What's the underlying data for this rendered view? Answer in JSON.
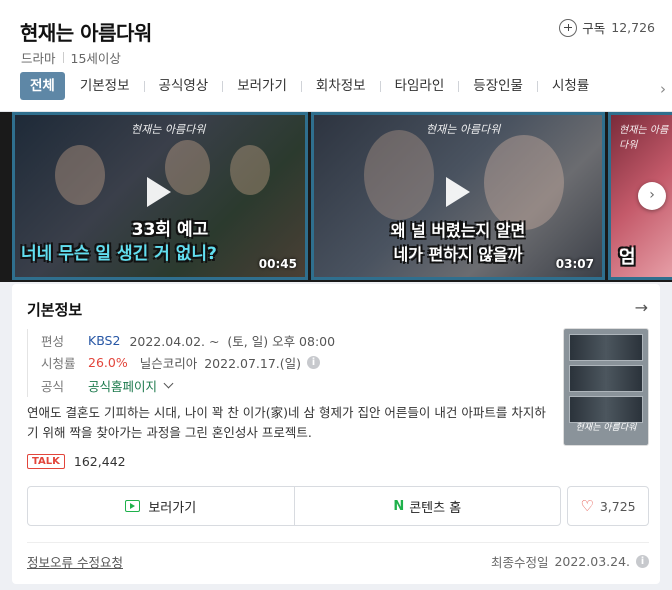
{
  "header": {
    "title": "현재는 아름다워",
    "genre": "드라마",
    "rating": "15세이상",
    "subscribe_label": "구독",
    "subscribe_count": "12,726"
  },
  "tabs": [
    {
      "label": "전체",
      "active": true
    },
    {
      "label": "기본정보"
    },
    {
      "label": "공식영상"
    },
    {
      "label": "보러가기"
    },
    {
      "label": "회차정보"
    },
    {
      "label": "타임라인"
    },
    {
      "label": "등장인물"
    },
    {
      "label": "시청률"
    }
  ],
  "videos": [
    {
      "logo": "현재는 아름다워",
      "caption_top": "33회 예고",
      "caption_bottom": "너네 무슨 일 생긴 거 없니?",
      "duration": "00:45"
    },
    {
      "logo": "현재는 아름다워",
      "caption_top": "왜 널 버렸는지 알면",
      "caption_bottom": "네가 편하지 않을까",
      "duration": "03:07"
    },
    {
      "logo": "현재는 아름다워",
      "caption_top": "",
      "caption_bottom": "엄",
      "duration": ""
    }
  ],
  "info": {
    "title": "기본정보",
    "schedule_key": "편성",
    "channel": "KBS2",
    "schedule": "2022.04.02. ~  (토, 일) 오후 08:00",
    "ratings_key": "시청률",
    "ratings_value": "26.0%",
    "ratings_source": "닐슨코리아",
    "ratings_date": "2022.07.17.(일)",
    "official_key": "공식",
    "official_link": "공식홈페이지",
    "description": "연애도 결혼도 기피하는 시대, 나이 꽉 찬 이가(家)네 삼 형제가 집안 어른들이 내건 아파트를 차지하기 위해 짝을 찾아가는 과정을 그린 혼인성사 프로젝트.",
    "poster_logo": "현재는 아름다워",
    "talk_label": "TALK",
    "talk_count": "162,442"
  },
  "actions": {
    "watch_label": "보러가기",
    "content_home_label": "콘텐츠 홈",
    "like_count": "3,725"
  },
  "footer": {
    "report_label": "정보오류 수정요청",
    "updated_label": "최종수정일",
    "updated_date": "2022.03.24."
  },
  "icons": {
    "subscribe": "plus-circle-icon",
    "next": "chevron-right-icon",
    "play": "play-icon",
    "info": "info-icon",
    "like": "heart-icon"
  },
  "colors": {
    "active_tab": "#5e87a6",
    "link": "#2857a5",
    "rating_red": "#e2453b",
    "naver_green": "#1eb14b"
  }
}
